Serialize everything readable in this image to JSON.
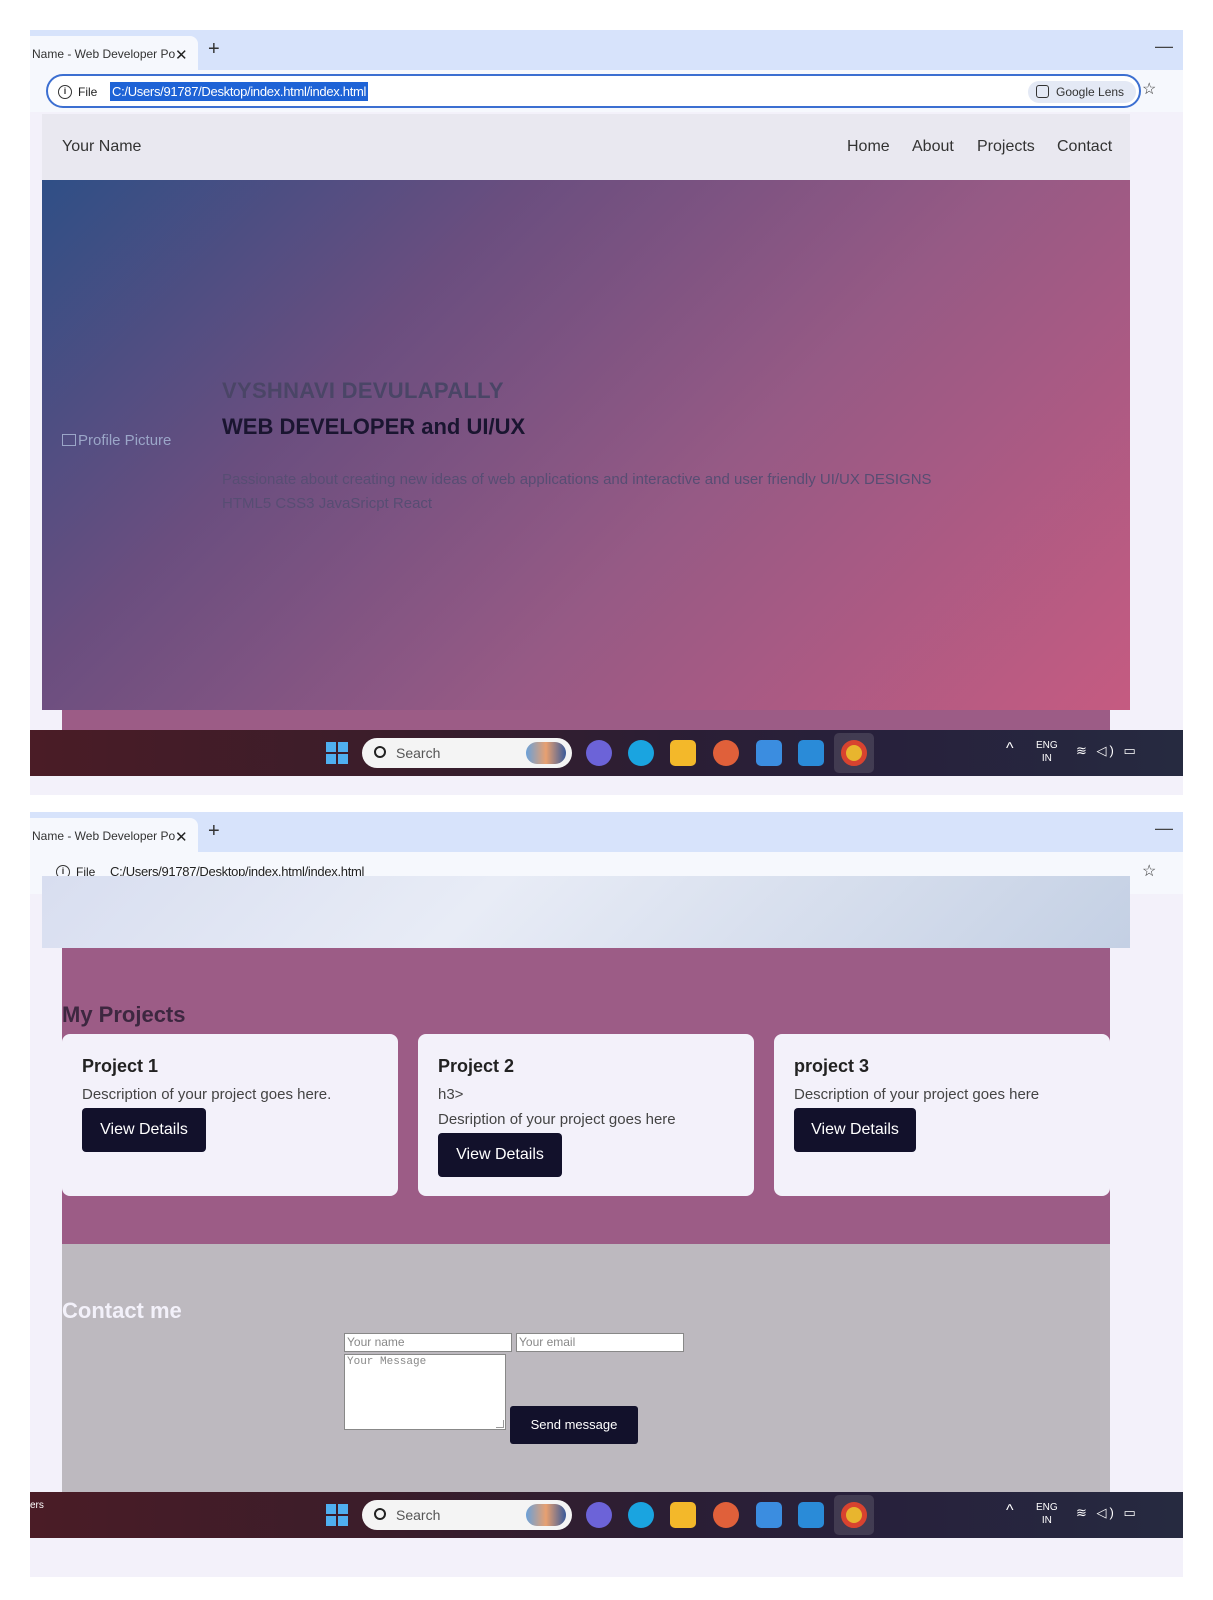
{
  "browser": {
    "tab_title": "Name - Web Developer Po",
    "file_label": "File",
    "url": "C:/Users/91787/Desktop/index.html/index.html",
    "google_lens_label": "Google Lens"
  },
  "navbar": {
    "brand": "Your Name",
    "links": [
      "Home",
      "About",
      "Projects",
      "Contact"
    ]
  },
  "hero": {
    "profile_alt": "Profile Picture",
    "name": "VYSHNAVI DEVULAPALLY",
    "role": "WEB DEVELOPER and UI/UX",
    "description": "Passionate about creating new ideas of web applications and interactive and user friendly UI/UX DESIGNS",
    "skills": "HTML5 CSS3 JavaSricpt React"
  },
  "projects": {
    "title": "My Projects",
    "cards": [
      {
        "title": "Project 1",
        "lines": [
          "Description of your project goes here."
        ],
        "button": "View Details"
      },
      {
        "title": "Project 2",
        "lines": [
          "h3>",
          "Desription of your project goes here"
        ],
        "button": "View Details"
      },
      {
        "title": "project 3",
        "lines": [
          "Description of your project goes here"
        ],
        "button": "View Details"
      }
    ]
  },
  "contact": {
    "title": "Contact me",
    "name_placeholder": "Your name",
    "email_placeholder": "Your email",
    "message_placeholder": "Your Message",
    "send_button": "Send message"
  },
  "taskbar": {
    "search_placeholder": "Search",
    "lang_top": "ENG",
    "lang_bottom": "IN",
    "edge_text": "ers"
  }
}
